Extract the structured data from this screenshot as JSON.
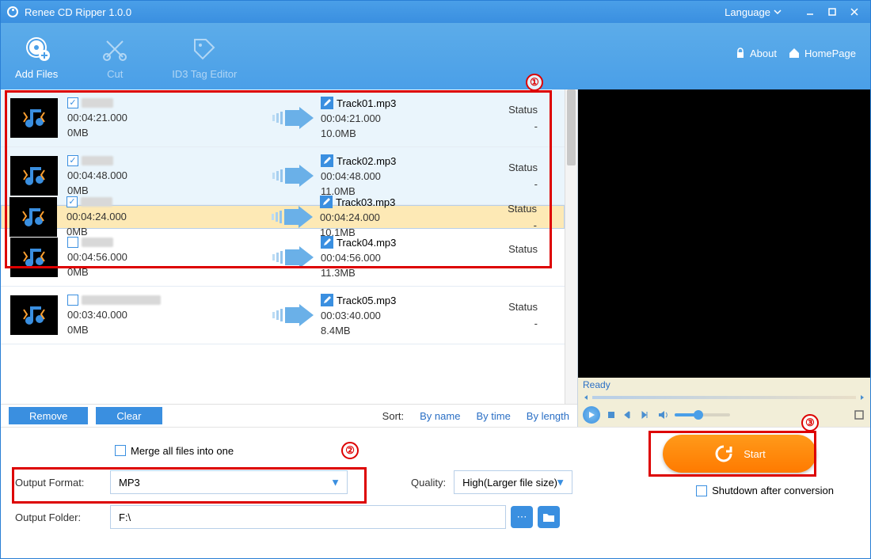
{
  "title": "Renee CD Ripper 1.0.0",
  "language_label": "Language",
  "toolbar": {
    "add_files": "Add Files",
    "cut": "Cut",
    "id3": "ID3 Tag Editor",
    "about": "About",
    "homepage": "HomePage"
  },
  "tracks": [
    {
      "checked": true,
      "selected": false,
      "plain": false,
      "src_duration": "00:04:21.000",
      "src_size": "0MB",
      "dst_name": "Track01.mp3",
      "dst_duration": "00:04:21.000",
      "dst_size": "10.0MB",
      "status_label": "Status",
      "status_value": "-"
    },
    {
      "checked": true,
      "selected": false,
      "plain": false,
      "src_duration": "00:04:48.000",
      "src_size": "0MB",
      "dst_name": "Track02.mp3",
      "dst_duration": "00:04:48.000",
      "dst_size": "11.0MB",
      "status_label": "Status",
      "status_value": "-"
    },
    {
      "checked": true,
      "selected": true,
      "plain": false,
      "src_duration": "00:04:24.000",
      "src_size": "0MB",
      "dst_name": "Track03.mp3",
      "dst_duration": "00:04:24.000",
      "dst_size": "10.1MB",
      "status_label": "Status",
      "status_value": "-"
    },
    {
      "checked": false,
      "selected": false,
      "plain": true,
      "src_duration": "00:04:56.000",
      "src_size": "0MB",
      "dst_name": "Track04.mp3",
      "dst_duration": "00:04:56.000",
      "dst_size": "11.3MB",
      "status_label": "Status",
      "status_value": "-"
    },
    {
      "checked": false,
      "selected": false,
      "plain": true,
      "src_duration": "00:03:40.000",
      "src_size": "0MB",
      "dst_name": "Track05.mp3",
      "dst_duration": "00:03:40.000",
      "dst_size": "8.4MB",
      "status_label": "Status",
      "status_value": "-"
    }
  ],
  "list_footer": {
    "remove": "Remove",
    "clear": "Clear",
    "sort_label": "Sort:",
    "by_name": "By name",
    "by_time": "By time",
    "by_length": "By length"
  },
  "preview": {
    "ready": "Ready"
  },
  "bottom": {
    "merge_label": "Merge all files into one",
    "output_format_label": "Output Format:",
    "output_format_value": "MP3",
    "quality_label": "Quality:",
    "quality_value": "High(Larger file size)",
    "output_folder_label": "Output Folder:",
    "output_folder_value": "F:\\",
    "start_label": "Start",
    "shutdown_label": "Shutdown after conversion"
  },
  "annot": {
    "b1": "①",
    "b2": "②",
    "b3": "③"
  }
}
